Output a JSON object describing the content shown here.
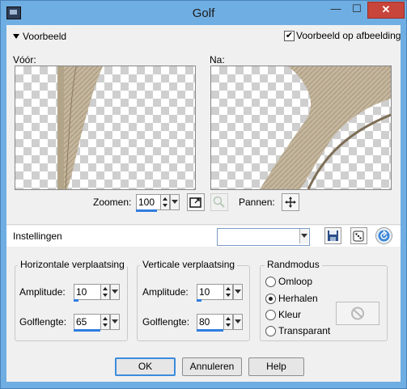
{
  "window": {
    "title": "Golf"
  },
  "preview_section": {
    "label": "Voorbeeld",
    "checkbox_label": "Voorbeeld op afbeelding",
    "checkbox_checked": true,
    "before_label": "Vóór:",
    "after_label": "Na:",
    "zoom_label": "Zoomen:",
    "zoom_value": "100",
    "pan_label": "Pannen:"
  },
  "settings": {
    "label": "Instellingen",
    "preset_value": ""
  },
  "horizontal": {
    "title": "Horizontale verplaatsing",
    "amplitude_label": "Amplitude:",
    "amplitude_value": "10",
    "wavelength_label": "Golflengte:",
    "wavelength_value": "65"
  },
  "vertical": {
    "title": "Verticale verplaatsing",
    "amplitude_label": "Amplitude:",
    "amplitude_value": "10",
    "wavelength_label": "Golflengte:",
    "wavelength_value": "80"
  },
  "edge_mode": {
    "title": "Randmodus",
    "options": [
      "Omloop",
      "Herhalen",
      "Kleur",
      "Transparant"
    ],
    "selected": "Herhalen"
  },
  "buttons": {
    "ok": "OK",
    "cancel": "Annuleren",
    "help": "Help"
  },
  "icons": {
    "app": "app-icon",
    "minimize": "minimize-icon",
    "maximize": "maximize-icon",
    "close": "close-icon",
    "zoom_fit": "zoom-fit-icon",
    "zoom_tool": "magnifier-icon",
    "pan": "move-icon",
    "save": "save-preset-icon",
    "random": "dice-icon",
    "reset": "reset-icon",
    "no_color": "no-color-icon"
  },
  "colors": {
    "accent": "#2f7de0",
    "titlebar": "#6faee2",
    "close": "#c7453a"
  }
}
